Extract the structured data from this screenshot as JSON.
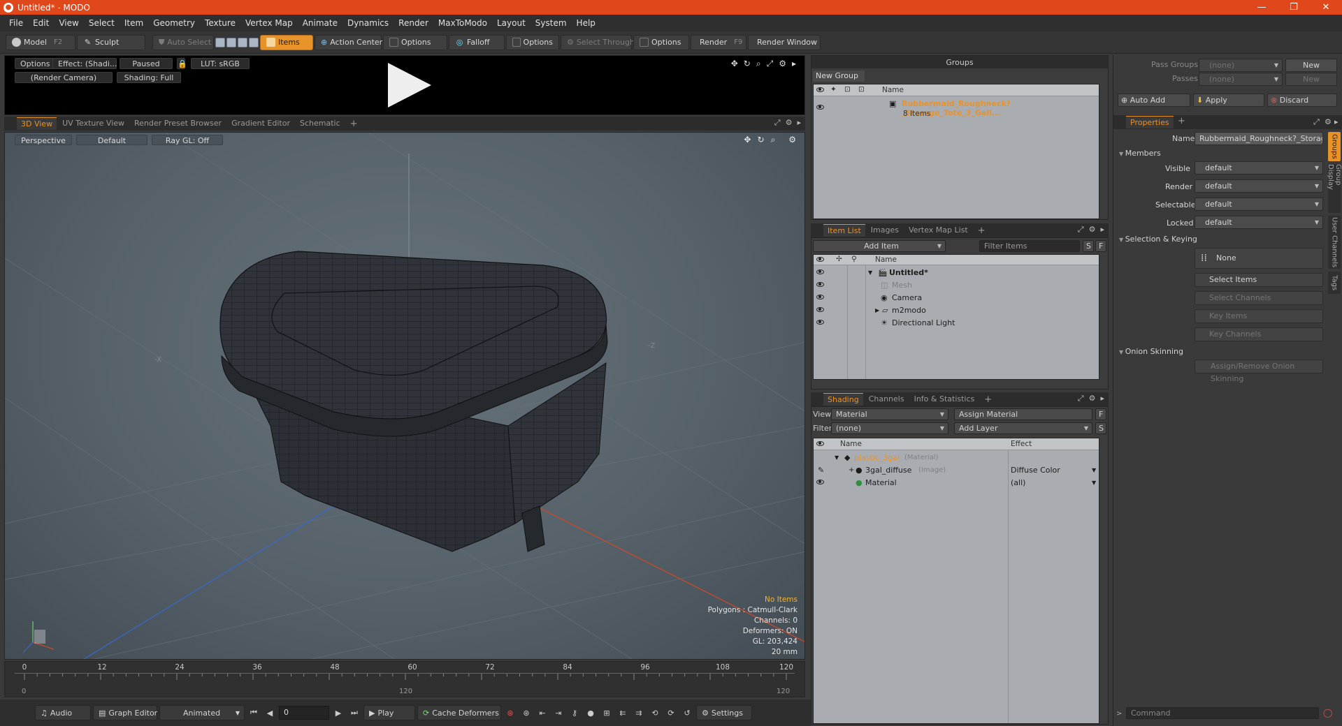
{
  "titlebar": {
    "title": "Untitled* - MODO",
    "app_icon": "modo-logo-icon",
    "minimize": "—",
    "maximize": "❐",
    "close": "✕"
  },
  "menubar": {
    "items": [
      "File",
      "Edit",
      "View",
      "Select",
      "Item",
      "Geometry",
      "Texture",
      "Vertex Map",
      "Animate",
      "Dynamics",
      "Render",
      "MaxToModo",
      "Layout",
      "System",
      "Help"
    ]
  },
  "toolbar": {
    "model": "Model",
    "model_key": "F2",
    "sculpt": "Sculpt",
    "auto_select": "Auto Select",
    "items": "Items",
    "action_center": "Action Center",
    "options1": "Options",
    "falloff": "Falloff",
    "options2": "Options",
    "select_through": "Select Through",
    "options3": "Options",
    "render": "Render",
    "render_key": "F9",
    "render_window": "Render Window"
  },
  "preview": {
    "options": "Options",
    "effect": "Effect: (Shadi...",
    "paused": "Paused",
    "lut": "LUT: sRGB",
    "camera": "(Render Camera)",
    "shading": "Shading: Full"
  },
  "viewtabs": {
    "tabs": [
      "3D View",
      "UV Texture View",
      "Render Preset Browser",
      "Gradient Editor",
      "Schematic"
    ],
    "plus": "+"
  },
  "viewport": {
    "perspective": "Perspective",
    "default": "Default",
    "raygl": "Ray GL: Off",
    "stats": {
      "no_items": "No Items",
      "polygons": "Polygons : Catmull-Clark",
      "channels": "Channels: 0",
      "deformers": "Deformers: ON",
      "gl": "GL: 203,424",
      "scale": "20 mm"
    },
    "axis_x": "-X",
    "axis_z": "-Z"
  },
  "timeline": {
    "ticks": [
      "0",
      "12",
      "24",
      "36",
      "48",
      "60",
      "72",
      "84",
      "96",
      "108",
      "120"
    ],
    "sub_start": "0",
    "sub_mid": "120",
    "sub_end": "120"
  },
  "bottombar": {
    "audio": "Audio",
    "graph_editor": "Graph Editor",
    "animated": "Animated",
    "frame": "0",
    "play": "Play",
    "cache_deformers": "Cache Deformers",
    "settings": "Settings"
  },
  "groups": {
    "title": "Groups",
    "new_group": "New Group",
    "col_name": "Name",
    "row_name": "Rubbermaid_Roughneck?_Storage_Tote_3_Gall...",
    "row_count": "8 Items"
  },
  "itemlist": {
    "tabs": [
      "Item List",
      "Images",
      "Vertex Map List"
    ],
    "plus": "+",
    "add_item": "Add Item",
    "filter_placeholder": "Filter Items",
    "s": "S",
    "f": "F",
    "col_name": "Name",
    "rows": [
      {
        "name": "Untitled*"
      },
      {
        "name": "Mesh"
      },
      {
        "name": "Camera"
      },
      {
        "name": "m2modo"
      },
      {
        "name": "Directional Light"
      }
    ]
  },
  "shading": {
    "tabs": [
      "Shading",
      "Channels",
      "Info & Statistics"
    ],
    "plus": "+",
    "view_label": "View",
    "view_value": "Material",
    "assign_material": "Assign Material",
    "f": "F",
    "filter_label": "Filter",
    "filter_value": "(none)",
    "add_layer": "Add Layer",
    "s": "S",
    "col_name": "Name",
    "col_effect": "Effect",
    "rows": [
      {
        "name": "plastic_3gal",
        "type": "(Material)",
        "effect": ""
      },
      {
        "name": "3gal_diffuse",
        "type": "(Image)",
        "effect": "Diffuse Color"
      },
      {
        "name": "Material",
        "type": "",
        "effect": "(all)"
      }
    ]
  },
  "right": {
    "pass_groups_label": "Pass Groups",
    "pass_groups_value": "(none)",
    "new1": "New",
    "passes_label": "Passes",
    "passes_value": "(none)",
    "new2": "New",
    "auto_add": "Auto Add",
    "apply": "Apply",
    "discard": "Discard",
    "properties_tab": "Properties",
    "plus": "+",
    "name_label": "Name",
    "name_value": "Rubbermaid_Roughneck?_Storage_",
    "members": "Members",
    "visible_label": "Visible",
    "visible_value": "default",
    "render_label": "Render",
    "render_value": "default",
    "selectable_label": "Selectable",
    "selectable_value": "default",
    "locked_label": "Locked",
    "locked_value": "default",
    "selection_keying": "Selection & Keying",
    "none": "None",
    "select_items": "Select Items",
    "select_channels": "Select Channels",
    "key_items": "Key Items",
    "key_channels": "Key Channels",
    "onion_skinning": "Onion Skinning",
    "assign_remove": "Assign/Remove Onion Skinning",
    "vtabs": [
      "Groups",
      "Group Display",
      "User Channels",
      "Tags"
    ],
    "command_placeholder": "Command"
  },
  "colors": {
    "titlebar": "#e0481b",
    "accent": "#e8922a",
    "viewport": "#5d6870",
    "mesh": "#2c3036",
    "list_bg": "#a9adb2"
  }
}
